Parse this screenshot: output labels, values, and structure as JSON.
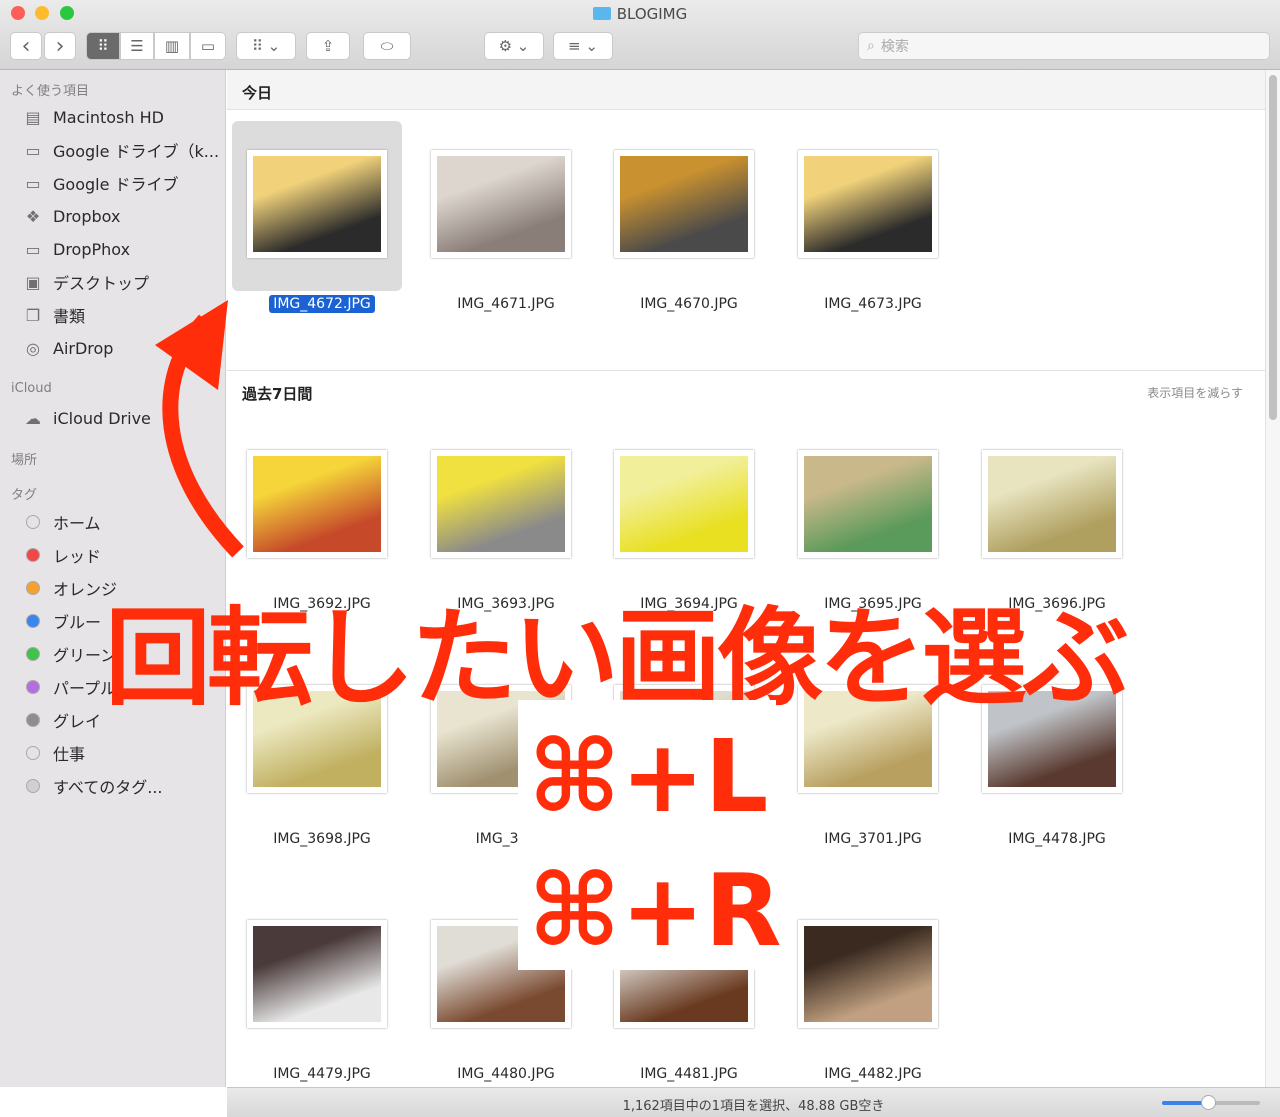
{
  "window": {
    "title": "BLOGIMG"
  },
  "toolbar": {
    "back": "‹",
    "forward": "›",
    "search_placeholder": "検索"
  },
  "sidebar": {
    "favorites_label": "よく使う項目",
    "favorites": [
      {
        "label": "Macintosh HD",
        "icon": "disk-icon"
      },
      {
        "label": "Google ドライブ（k...",
        "icon": "folder-icon"
      },
      {
        "label": "Google ドライブ",
        "icon": "folder-icon"
      },
      {
        "label": "Dropbox",
        "icon": "dropbox-icon"
      },
      {
        "label": "DropPhox",
        "icon": "folder-icon"
      },
      {
        "label": "デスクトップ",
        "icon": "desktop-icon"
      },
      {
        "label": "書類",
        "icon": "documents-icon"
      },
      {
        "label": "AirDrop",
        "icon": "airdrop-icon"
      }
    ],
    "icloud_label": "iCloud",
    "icloud": [
      {
        "label": "iCloud Drive",
        "icon": "cloud-icon"
      }
    ],
    "locations_label": "場所",
    "tags_label": "タグ",
    "tags": [
      {
        "label": "ホーム",
        "color": "#e4e4e4"
      },
      {
        "label": "レッド",
        "color": "#f0484a"
      },
      {
        "label": "オレンジ",
        "color": "#f5a030"
      },
      {
        "label": "ブルー",
        "color": "#3a86f0"
      },
      {
        "label": "グリーン",
        "color": "#40c34a"
      },
      {
        "label": "パープル",
        "color": "#b46ee0"
      },
      {
        "label": "グレイ",
        "color": "#8e8e8e"
      },
      {
        "label": "仕事",
        "color": "#e4e4e4"
      },
      {
        "label": "すべてのタグ...",
        "color": "#d0d0d0"
      }
    ]
  },
  "groups": [
    {
      "title": "今日",
      "files": [
        {
          "name": "IMG_4672.JPG",
          "selected": true,
          "colors": [
            "#f1d27a",
            "#2b2b2b"
          ]
        },
        {
          "name": "IMG_4671.JPG",
          "colors": [
            "#ddd6cf",
            "#8a7f78"
          ]
        },
        {
          "name": "IMG_4670.JPG",
          "colors": [
            "#c9912f",
            "#4a4a4a"
          ]
        },
        {
          "name": "IMG_4673.JPG",
          "colors": [
            "#f1d27a",
            "#2b2b2b"
          ]
        }
      ]
    },
    {
      "title": "過去7日間",
      "action": "表示項目を減らす",
      "files": [
        {
          "name": "IMG_3692.JPG",
          "colors": [
            "#f5d53a",
            "#c64a2a"
          ]
        },
        {
          "name": "IMG_3693.JPG",
          "colors": [
            "#f0e040",
            "#8a8a8a"
          ]
        },
        {
          "name": "IMG_3694.JPG",
          "colors": [
            "#f2ef9a",
            "#e8e020"
          ]
        },
        {
          "name": "IMG_3695.JPG",
          "colors": [
            "#c9b88a",
            "#5a9a5a"
          ]
        },
        {
          "name": "IMG_3696.JPG",
          "colors": [
            "#e8e4c0",
            "#b0a060"
          ]
        },
        {
          "name": "IMG_3698.JPG",
          "colors": [
            "#ece8c0",
            "#c0b060"
          ]
        },
        {
          "name": "IMG_369",
          "colors": [
            "#e8e4d0",
            "#a09070"
          ]
        },
        {
          "name": "",
          "colors": [
            "#e0dcd0",
            "#c0a070"
          ]
        },
        {
          "name": "IMG_3701.JPG",
          "colors": [
            "#ede8c8",
            "#b8a060"
          ]
        },
        {
          "name": "IMG_4478.JPG",
          "colors": [
            "#c0c4c8",
            "#5a3a30"
          ]
        },
        {
          "name": "IMG_4479.JPG",
          "colors": [
            "#4a3a3a",
            "#e8e8e8"
          ]
        },
        {
          "name": "IMG_4480.JPG",
          "colors": [
            "#e0dcd6",
            "#7a4a30"
          ]
        },
        {
          "name": "IMG_4481.JPG",
          "colors": [
            "#d0c8c0",
            "#6a3a20"
          ]
        },
        {
          "name": "IMG_4482.JPG",
          "colors": [
            "#3a2a20",
            "#c0a080"
          ]
        }
      ]
    }
  ],
  "status": {
    "text": "1,162項目中の1項目を選択、48.88 GB空き",
    "icon_size": 0.45
  },
  "annotation": {
    "headline": "回転したい画像を選ぶ",
    "shortcut_left": "⌘+L",
    "shortcut_right": "⌘+R",
    "color": "#ff2d0a"
  }
}
